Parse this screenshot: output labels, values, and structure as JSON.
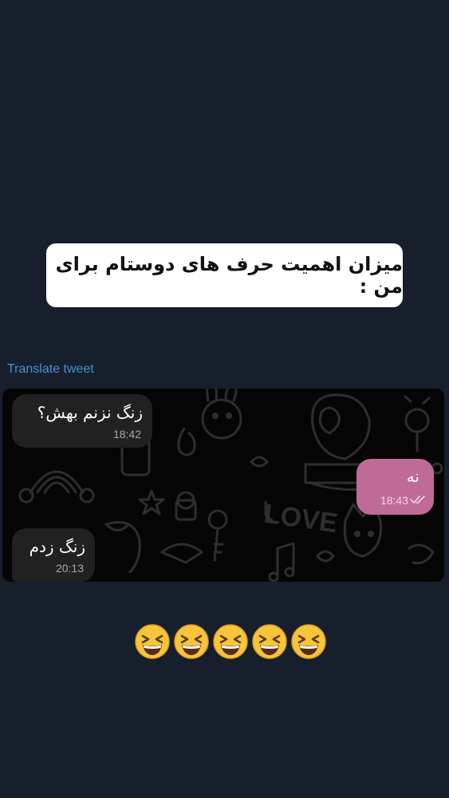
{
  "caption": "میزان اهمیت حرف های دوستام برای من :",
  "translate_link": "Translate tweet",
  "messages": [
    {
      "text": "زنگ نزنم بهش؟",
      "time": "18:42",
      "direction": "incoming"
    },
    {
      "text": "نه",
      "time": "18:43",
      "direction": "outgoing",
      "status": "read-double-check"
    },
    {
      "text": "زنگ زدم",
      "time": "20:13",
      "direction": "incoming"
    }
  ],
  "reaction_emojis": [
    "grinning-squinting-face",
    "grinning-squinting-face",
    "grinning-squinting-face",
    "grinning-squinting-face",
    "grinning-squinting-face"
  ],
  "colors": {
    "page_background": "#161f2b",
    "chat_background": "#050505",
    "incoming_bubble": "#212121",
    "outgoing_bubble": "#c06b97",
    "link": "#4a90d9"
  }
}
